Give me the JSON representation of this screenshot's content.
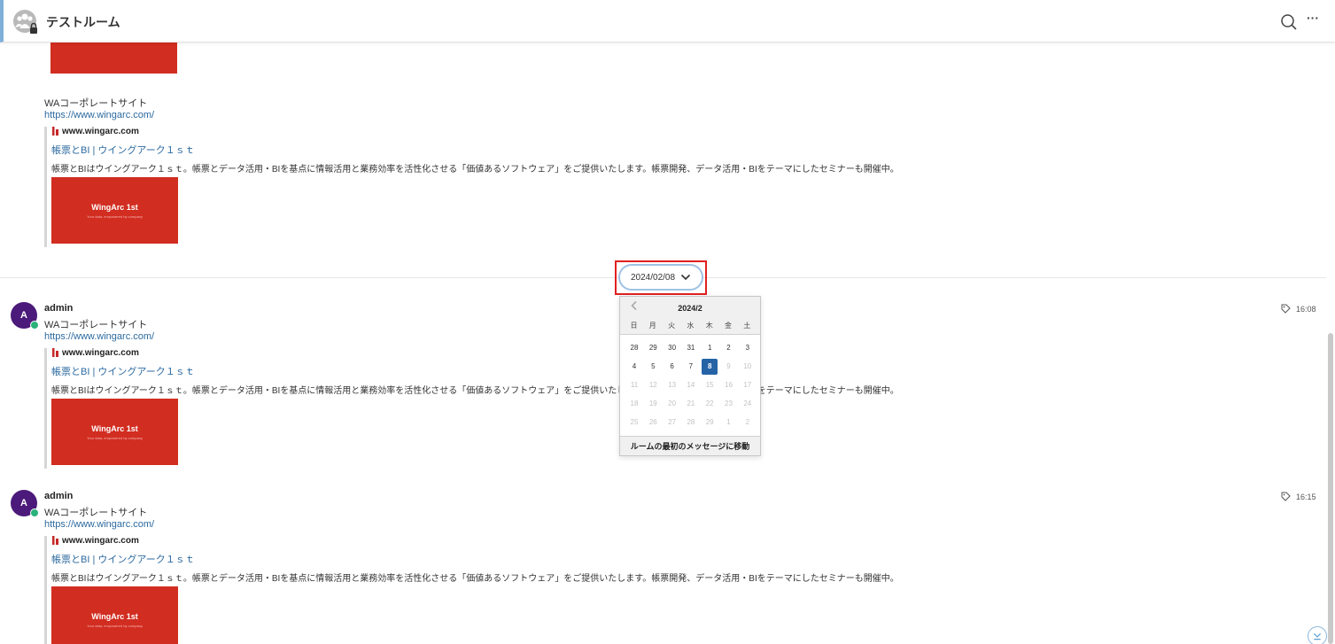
{
  "header": {
    "room_title": "テストルーム",
    "more_label": "···"
  },
  "preview": {
    "site": "www.wingarc.com",
    "title": "帳票とBI | ウイングアーク１ｓｔ",
    "description": "帳票とBIはウイングアーク１ｓｔ。帳票とデータ活用・BIを基点に情報活用と業務効率を活性化させる「価値あるソフトウェア」をご提供いたします。帳票開発、データ活用・BIをテーマにしたセミナーも開催中。",
    "image_brand": "WingArc 1st",
    "image_tagline": "Your data, empowered by company"
  },
  "messages": [
    {
      "author": "",
      "avatar": "",
      "text": "WAコーポレートサイト",
      "link": "https://www.wingarc.com/",
      "time": ""
    },
    {
      "author": "admin",
      "avatar": "A",
      "text": "WAコーポレートサイト",
      "link": "https://www.wingarc.com/",
      "time": "16:08"
    },
    {
      "author": "admin",
      "avatar": "A",
      "text": "WAコーポレートサイト",
      "link": "https://www.wingarc.com/",
      "time": "16:15"
    }
  ],
  "date_chip": {
    "label": "2024/02/08"
  },
  "calendar": {
    "month": "2024/2",
    "weekdays": [
      "日",
      "月",
      "火",
      "水",
      "木",
      "金",
      "土"
    ],
    "weeks": [
      [
        "28",
        "29",
        "30",
        "31",
        "1",
        "2",
        "3"
      ],
      [
        "4",
        "5",
        "6",
        "7",
        "8",
        "9",
        "10"
      ],
      [
        "11",
        "12",
        "13",
        "14",
        "15",
        "16",
        "17"
      ],
      [
        "18",
        "19",
        "20",
        "21",
        "22",
        "23",
        "24"
      ],
      [
        "25",
        "26",
        "27",
        "28",
        "29",
        "1",
        "2"
      ]
    ],
    "selected": "8",
    "footer": "ルームの最初のメッセージに移動"
  },
  "colors": {
    "accent": "#2563a6",
    "avatar": "#4b1a7a",
    "presence": "#2ab27b",
    "highlight": "#e02020",
    "link": "#2c6aa0"
  }
}
